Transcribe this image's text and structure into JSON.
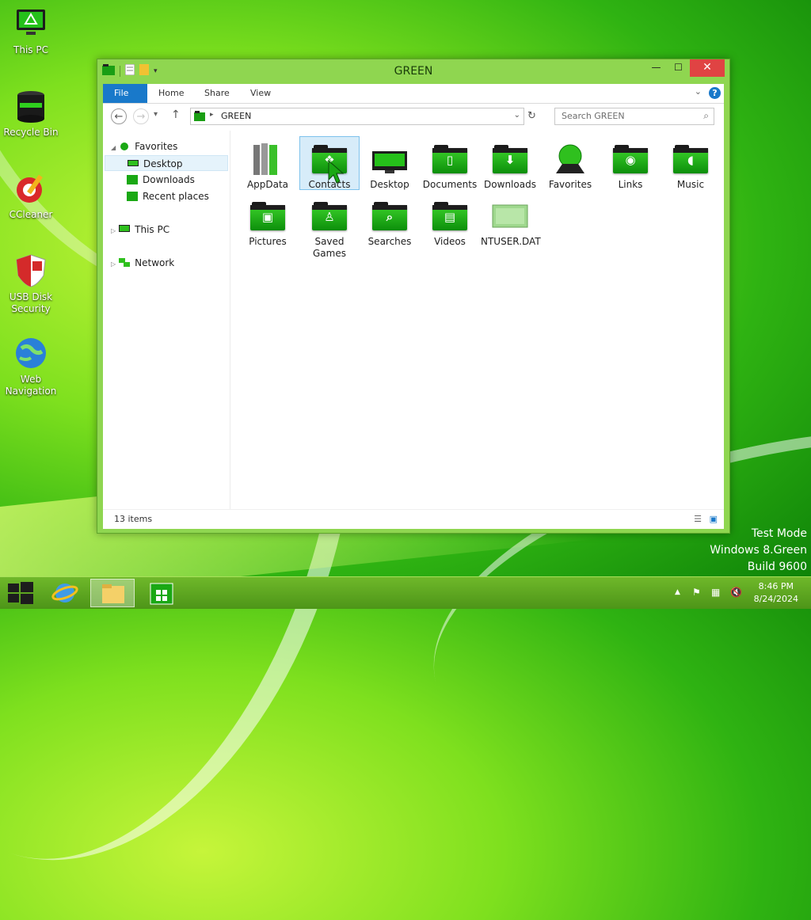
{
  "desktop": {
    "icons": [
      {
        "label": "This PC"
      },
      {
        "label": "Recycle Bin"
      },
      {
        "label": "CCleaner"
      },
      {
        "label": "USB Disk Security"
      },
      {
        "label": "Web Navigation"
      }
    ],
    "watermark": {
      "line1": "Test Mode",
      "line2": "Windows 8.Green",
      "line3": "Build 9600"
    }
  },
  "window": {
    "title": "GREEN",
    "ribbon_tabs": [
      "File",
      "Home",
      "Share",
      "View"
    ],
    "address": {
      "path": "GREEN"
    },
    "search": {
      "placeholder": "Search GREEN"
    },
    "nav": {
      "favorites": "Favorites",
      "favorites_items": [
        "Desktop",
        "Downloads",
        "Recent places"
      ],
      "this_pc": "This PC",
      "network": "Network"
    },
    "items": [
      {
        "label": "AppData"
      },
      {
        "label": "Contacts"
      },
      {
        "label": "Desktop"
      },
      {
        "label": "Documents"
      },
      {
        "label": "Downloads"
      },
      {
        "label": "Favorites"
      },
      {
        "label": "Links"
      },
      {
        "label": "Music"
      },
      {
        "label": "Pictures"
      },
      {
        "label": "Saved Games"
      },
      {
        "label": "Searches"
      },
      {
        "label": "Videos"
      },
      {
        "label": "NTUSER.DAT"
      }
    ],
    "status": "13 items"
  },
  "taskbar": {
    "time": "8:46 PM",
    "date": "8/24/2024"
  },
  "colors": {
    "accent": "#1979ca",
    "folder_green": "#22b31a",
    "close_red": "#e04343",
    "window_frame": "#8fd650"
  }
}
